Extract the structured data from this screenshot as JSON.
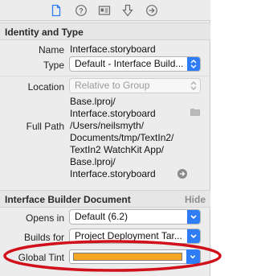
{
  "tabs": [
    {
      "icon": "file-inspector-icon",
      "selected": true
    },
    {
      "icon": "quick-help-icon",
      "selected": false
    },
    {
      "icon": "identity-card-icon",
      "selected": false
    },
    {
      "icon": "attributes-down-arrow-icon",
      "selected": false
    },
    {
      "icon": "connections-arrow-icon",
      "selected": false
    }
  ],
  "identity": {
    "title": "Identity and Type",
    "name_label": "Name",
    "name_value": "Interface.storyboard",
    "type_label": "Type",
    "type_value": "Default - Interface Build...",
    "location_label": "Location",
    "location_value": "Relative to Group",
    "base_line1": "Base.lproj/",
    "base_line2": "Interface.storyboard",
    "fullpath_label": "Full Path",
    "fullpath_lines": [
      "/Users/neilsmyth/",
      "Documents/tmp/TextIn2/",
      "TextIn2 WatchKit App/",
      "Base.lproj/",
      "Interface.storyboard"
    ]
  },
  "ibdoc": {
    "title": "Interface Builder Document",
    "hide_label": "Hide",
    "opens_in_label": "Opens in",
    "opens_in_value": "Default (6.2)",
    "builds_for_label": "Builds for",
    "builds_for_value": "Project Deployment Tar...",
    "global_tint_label": "Global Tint",
    "global_tint_color": "#f5a623"
  },
  "colors": {
    "accent": "#2e7cf6",
    "highlight": "#d0101a"
  }
}
